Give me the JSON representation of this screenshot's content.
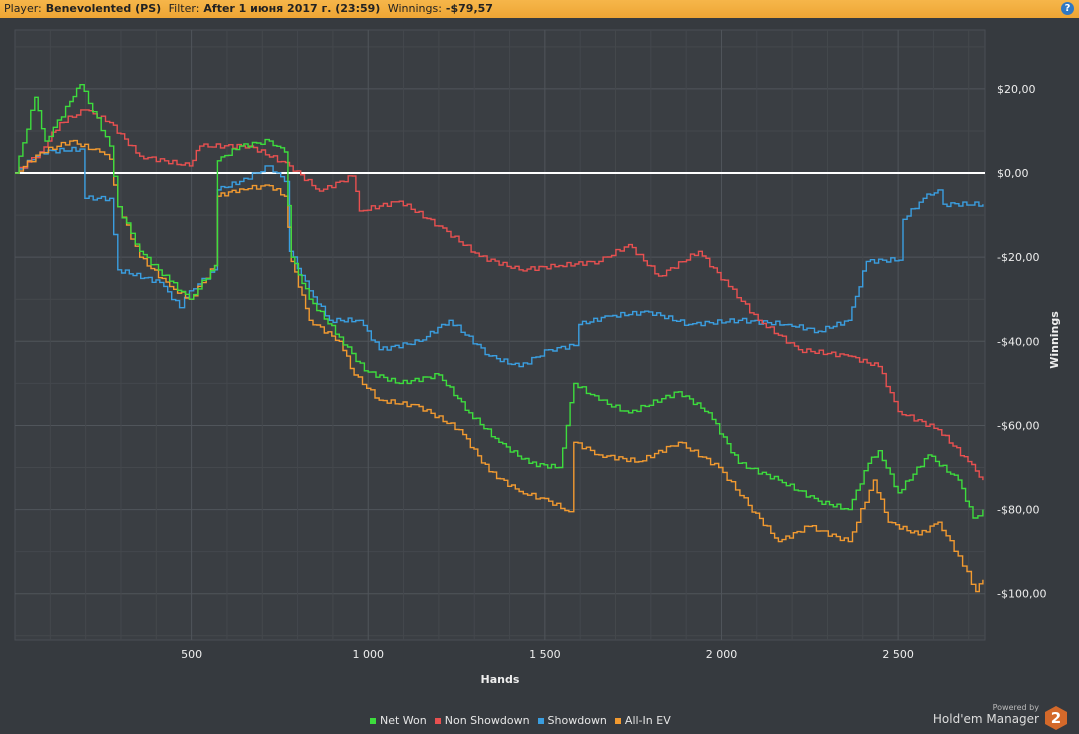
{
  "header": {
    "player_label": "Player:",
    "player": "Benevolented (PS)",
    "filter_label": "Filter:",
    "filter": "After 1 июня 2017 г. (23:59)",
    "winnings_label": "Winnings:",
    "winnings": "-$79,57",
    "help": "?"
  },
  "branding": {
    "powered_by": "Powered by",
    "product": "Hold'em Manager",
    "badge": "2"
  },
  "chart_data": {
    "type": "line",
    "xlabel": "Hands",
    "ylabel": "Winnings",
    "xlim": [
      0,
      2746
    ],
    "ylim": [
      -111,
      34
    ],
    "x_ticks": [
      500,
      1000,
      1500,
      2000,
      2500
    ],
    "x_tick_labels": [
      "500",
      "1 000",
      "1 500",
      "2 000",
      "2 500"
    ],
    "y_ticks": [
      20,
      0,
      -20,
      -40,
      -60,
      -80,
      -100
    ],
    "y_tick_labels": [
      "$20,00",
      "$0,00",
      "-$20,00",
      "-$40,00",
      "-$60,00",
      "-$80,00",
      "-$100,00"
    ],
    "grid": true,
    "legend_position": "bottom",
    "series": [
      {
        "name": "Net Won",
        "color": "#3ddc3d",
        "points": [
          [
            0,
            0
          ],
          [
            56,
            18
          ],
          [
            85,
            7.6
          ],
          [
            155,
            17
          ],
          [
            184,
            21
          ],
          [
            268,
            6.4
          ],
          [
            291,
            -8
          ],
          [
            353,
            -18.6
          ],
          [
            438,
            -25.7
          ],
          [
            494,
            -30
          ],
          [
            565,
            -22
          ],
          [
            573,
            2.9
          ],
          [
            636,
            6.4
          ],
          [
            720,
            7.6
          ],
          [
            763,
            5
          ],
          [
            782,
            -20
          ],
          [
            833,
            -30
          ],
          [
            918,
            -39
          ],
          [
            989,
            -47
          ],
          [
            1088,
            -50
          ],
          [
            1200,
            -48
          ],
          [
            1285,
            -57
          ],
          [
            1370,
            -64
          ],
          [
            1455,
            -69
          ],
          [
            1540,
            -70
          ],
          [
            1582,
            -50
          ],
          [
            1653,
            -54
          ],
          [
            1737,
            -57
          ],
          [
            1878,
            -52
          ],
          [
            1963,
            -57
          ],
          [
            2048,
            -69
          ],
          [
            2161,
            -73
          ],
          [
            2274,
            -78
          ],
          [
            2359,
            -80
          ],
          [
            2415,
            -69
          ],
          [
            2444,
            -66
          ],
          [
            2500,
            -76
          ],
          [
            2585,
            -67
          ],
          [
            2670,
            -73
          ],
          [
            2712,
            -82
          ],
          [
            2740,
            -80
          ]
        ]
      },
      {
        "name": "Non Showdown",
        "color": "#e85050",
        "points": [
          [
            0,
            0
          ],
          [
            71,
            5
          ],
          [
            127,
            12
          ],
          [
            198,
            15
          ],
          [
            268,
            12
          ],
          [
            353,
            4
          ],
          [
            494,
            1.7
          ],
          [
            523,
            6.4
          ],
          [
            664,
            6.4
          ],
          [
            777,
            1.7
          ],
          [
            862,
            -4.3
          ],
          [
            955,
            -0.7
          ],
          [
            975,
            -9
          ],
          [
            1088,
            -6.7
          ],
          [
            1200,
            -12.6
          ],
          [
            1314,
            -19.8
          ],
          [
            1427,
            -23
          ],
          [
            1540,
            -22
          ],
          [
            1653,
            -21
          ],
          [
            1737,
            -17
          ],
          [
            1822,
            -24.5
          ],
          [
            1935,
            -18.6
          ],
          [
            2020,
            -27
          ],
          [
            2104,
            -35
          ],
          [
            2218,
            -42
          ],
          [
            2359,
            -43.5
          ],
          [
            2444,
            -46
          ],
          [
            2500,
            -56.7
          ],
          [
            2613,
            -61
          ],
          [
            2698,
            -68.6
          ],
          [
            2740,
            -73
          ]
        ]
      },
      {
        "name": "Showdown",
        "color": "#3a9ee0",
        "points": [
          [
            0,
            0
          ],
          [
            71,
            5
          ],
          [
            184,
            5.7
          ],
          [
            198,
            -6
          ],
          [
            268,
            -6
          ],
          [
            291,
            -23
          ],
          [
            410,
            -26
          ],
          [
            466,
            -32
          ],
          [
            494,
            -28
          ],
          [
            565,
            -23
          ],
          [
            573,
            -4
          ],
          [
            636,
            -2
          ],
          [
            720,
            1.7
          ],
          [
            763,
            -2
          ],
          [
            777,
            -18.6
          ],
          [
            833,
            -28
          ],
          [
            890,
            -35
          ],
          [
            975,
            -35
          ],
          [
            1031,
            -42
          ],
          [
            1144,
            -40
          ],
          [
            1229,
            -35
          ],
          [
            1342,
            -43.5
          ],
          [
            1427,
            -46
          ],
          [
            1511,
            -42
          ],
          [
            1582,
            -41
          ],
          [
            1596,
            -36
          ],
          [
            1681,
            -34
          ],
          [
            1794,
            -33
          ],
          [
            1907,
            -36
          ],
          [
            2048,
            -35
          ],
          [
            2189,
            -36
          ],
          [
            2274,
            -37.6
          ],
          [
            2359,
            -35
          ],
          [
            2410,
            -21
          ],
          [
            2514,
            -20.5
          ],
          [
            2514,
            -11
          ],
          [
            2571,
            -6
          ],
          [
            2613,
            -4
          ],
          [
            2627,
            -7.4
          ],
          [
            2740,
            -7.4
          ]
        ]
      },
      {
        "name": "All-In EV",
        "color": "#f29a30",
        "points": [
          [
            0,
            0
          ],
          [
            71,
            4.8
          ],
          [
            155,
            7.6
          ],
          [
            240,
            5
          ],
          [
            268,
            3.3
          ],
          [
            291,
            -8
          ],
          [
            353,
            -20
          ],
          [
            438,
            -27
          ],
          [
            494,
            -30
          ],
          [
            565,
            -22
          ],
          [
            573,
            -5.5
          ],
          [
            636,
            -3.8
          ],
          [
            720,
            -3
          ],
          [
            763,
            -5.5
          ],
          [
            782,
            -21
          ],
          [
            833,
            -35
          ],
          [
            918,
            -40
          ],
          [
            960,
            -48
          ],
          [
            1031,
            -54
          ],
          [
            1144,
            -55.5
          ],
          [
            1257,
            -61
          ],
          [
            1342,
            -71
          ],
          [
            1427,
            -75.7
          ],
          [
            1511,
            -78
          ],
          [
            1568,
            -80.5
          ],
          [
            1582,
            -64
          ],
          [
            1653,
            -67
          ],
          [
            1766,
            -68.6
          ],
          [
            1878,
            -64
          ],
          [
            1992,
            -70
          ],
          [
            2076,
            -79
          ],
          [
            2161,
            -87.6
          ],
          [
            2246,
            -84
          ],
          [
            2359,
            -87.6
          ],
          [
            2430,
            -73
          ],
          [
            2472,
            -83
          ],
          [
            2557,
            -86
          ],
          [
            2613,
            -83
          ],
          [
            2670,
            -91
          ],
          [
            2720,
            -99.5
          ],
          [
            2740,
            -96.7
          ]
        ]
      }
    ]
  }
}
